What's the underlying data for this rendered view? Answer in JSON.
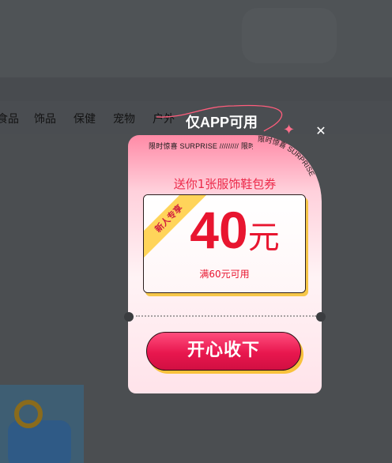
{
  "background": {
    "nav_items": [
      "食品",
      "饰品",
      "保健",
      "宠物",
      "户外"
    ]
  },
  "popup": {
    "app_only_label": "仅APP可用",
    "close_icon": "close-icon",
    "ticker_text": "限时惊喜 SURPRISE ///////// 限时惊喜 SURPRISE",
    "gift_text": "送你1张服饰鞋包券",
    "ribbon_label": "新人专享",
    "amount_value": "40",
    "amount_unit": "元",
    "condition_text": "满60元可用",
    "accept_button": "开心收下"
  },
  "colors": {
    "accent_red": "#e8152f",
    "button_pink": "#e8174e",
    "gold_shadow": "#f9c23c",
    "ribbon_yellow": "#ffd45a"
  }
}
